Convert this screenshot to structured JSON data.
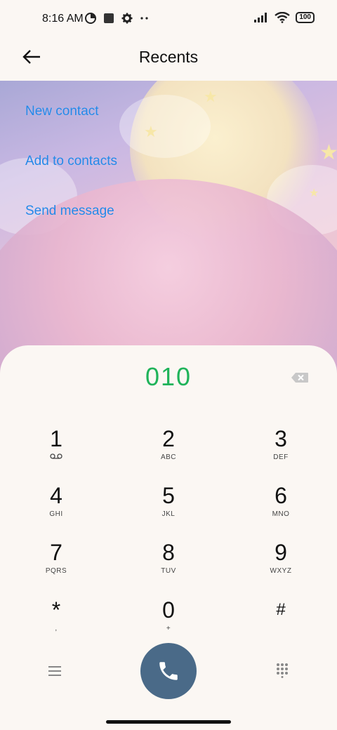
{
  "status_bar": {
    "time": "8:16 AM",
    "battery": "100"
  },
  "header": {
    "title": "Recents"
  },
  "actions": [
    {
      "label": "New contact"
    },
    {
      "label": "Add to contacts"
    },
    {
      "label": "Send message"
    }
  ],
  "dialer": {
    "number": "010",
    "keys": [
      {
        "digit": "1",
        "letters": ""
      },
      {
        "digit": "2",
        "letters": "ABC"
      },
      {
        "digit": "3",
        "letters": "DEF"
      },
      {
        "digit": "4",
        "letters": "GHI"
      },
      {
        "digit": "5",
        "letters": "JKL"
      },
      {
        "digit": "6",
        "letters": "MNO"
      },
      {
        "digit": "7",
        "letters": "PQRS"
      },
      {
        "digit": "8",
        "letters": "TUV"
      },
      {
        "digit": "9",
        "letters": "WXYZ"
      },
      {
        "digit": "*",
        "letters": ","
      },
      {
        "digit": "0",
        "letters": "+"
      },
      {
        "digit": "#",
        "letters": ""
      }
    ]
  },
  "colors": {
    "accent_blue": "#2387e8",
    "number_green": "#1fb35a",
    "call_button": "#4a6a88"
  }
}
